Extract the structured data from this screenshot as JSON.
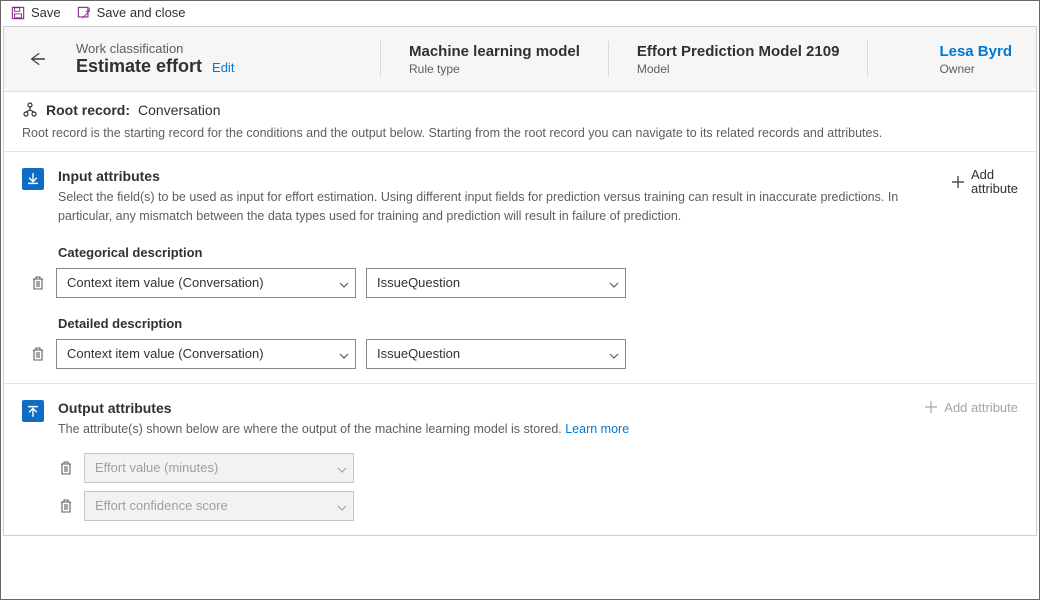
{
  "toolbar": {
    "save": "Save",
    "save_close": "Save and close"
  },
  "header": {
    "breadcrumb": "Work classification",
    "title": "Estimate effort",
    "edit": "Edit",
    "rule_type_value": "Machine learning model",
    "rule_type_label": "Rule type",
    "model_value": "Effort Prediction Model 2109",
    "model_label": "Model",
    "owner_name": "Lesa Byrd",
    "owner_label": "Owner"
  },
  "root": {
    "label": "Root record:",
    "value": "Conversation",
    "desc": "Root record is the starting record for the conditions and the output below. Starting from the root record you can navigate to its related records and attributes."
  },
  "input": {
    "title": "Input attributes",
    "desc": "Select the field(s) to be used as input for effort estimation. Using different input fields for prediction versus training can result in inaccurate predictions. In particular, any mismatch between the data types used for training and prediction will result in failure of prediction.",
    "add_line1": "Add",
    "add_line2": "attribute",
    "groups": [
      {
        "label": "Categorical description",
        "field1": "Context item value (Conversation)",
        "field2": "IssueQuestion"
      },
      {
        "label": "Detailed description",
        "field1": "Context item value (Conversation)",
        "field2": "IssueQuestion"
      }
    ]
  },
  "output": {
    "title": "Output attributes",
    "desc_prefix": "The attribute(s) shown below are where the output of the machine learning model is stored.  ",
    "learn_more": "Learn more",
    "add": "Add attribute",
    "rows": [
      "Effort value (minutes)",
      "Effort confidence score"
    ]
  }
}
